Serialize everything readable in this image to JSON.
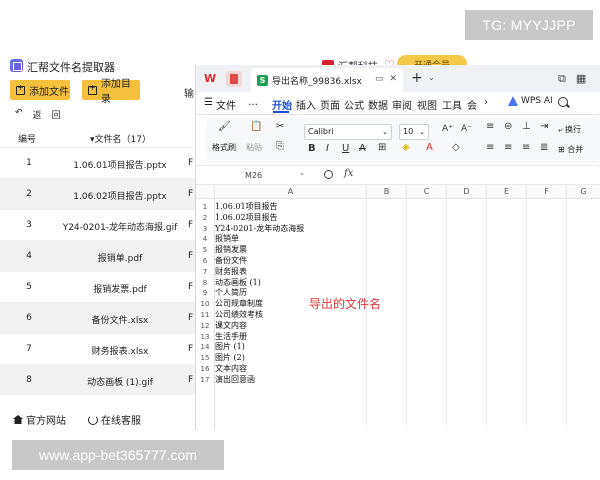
{
  "watermarks": {
    "top_right": "TG: MYYJJPP",
    "bottom_left": "www.app-bet365777.com"
  },
  "app": {
    "title": "汇帮文件名提取器",
    "brand": "汇帮科技",
    "vip_label": "开通会员",
    "toolbar": {
      "add_file": "添加文件",
      "add_dir": "添加目录",
      "more": "输"
    },
    "back_label": "返",
    "back_label2": "回",
    "table": {
      "headers": {
        "num": "编号",
        "name": "▾文件名（17）"
      },
      "rows": [
        {
          "num": "1",
          "name": "1.06.01项目报告.pptx",
          "trunc": "F"
        },
        {
          "num": "2",
          "name": "1.06.02项目报告.pptx",
          "trunc": "F"
        },
        {
          "num": "3",
          "name": "Y24-0201-龙年动态海报.gif",
          "trunc": "F"
        },
        {
          "num": "4",
          "name": "报销单.pdf",
          "trunc": "F"
        },
        {
          "num": "5",
          "name": "报销发票.pdf",
          "trunc": "F"
        },
        {
          "num": "6",
          "name": "备份文件.xlsx",
          "trunc": "F"
        },
        {
          "num": "7",
          "name": "财务报表.xlsx",
          "trunc": "F"
        },
        {
          "num": "8",
          "name": "动态画板 (1).gif",
          "trunc": "F"
        }
      ]
    },
    "footer": {
      "website": "官方网站",
      "service": "在线客服"
    }
  },
  "spreadsheet": {
    "tab_title": "导出名称_99836.xlsx",
    "xl_badge": "S",
    "menu": [
      "文件",
      "…",
      "开始",
      "插入",
      "页面",
      "公式",
      "数据",
      "审阅",
      "视图",
      "工具",
      "会员"
    ],
    "menu_prefix": "☰",
    "wps_ai": "WPS AI",
    "ribbon": {
      "format_painter": "格式刷",
      "paste": "粘贴",
      "font": "Calibri",
      "size": "10",
      "wrap": "换行",
      "merge": "合并"
    },
    "name_box": "M26",
    "fx": "fx",
    "columns": [
      "A",
      "B",
      "C",
      "D",
      "E",
      "F",
      "G"
    ],
    "rows": [
      "1.06.01项目报告",
      "1.06.02项目报告",
      "Y24-0201-龙年动态海报",
      "报销单",
      "报销发票",
      "备份文件",
      "财务报表",
      "动态画板 (1)",
      "个人简历",
      "公司规章制度",
      "公司绩效考核",
      "课文内容",
      "生活手册",
      "图片 (1)",
      "图片 (2)",
      "文本内容",
      "演出回意函"
    ],
    "annotation": "导出的文件名"
  }
}
